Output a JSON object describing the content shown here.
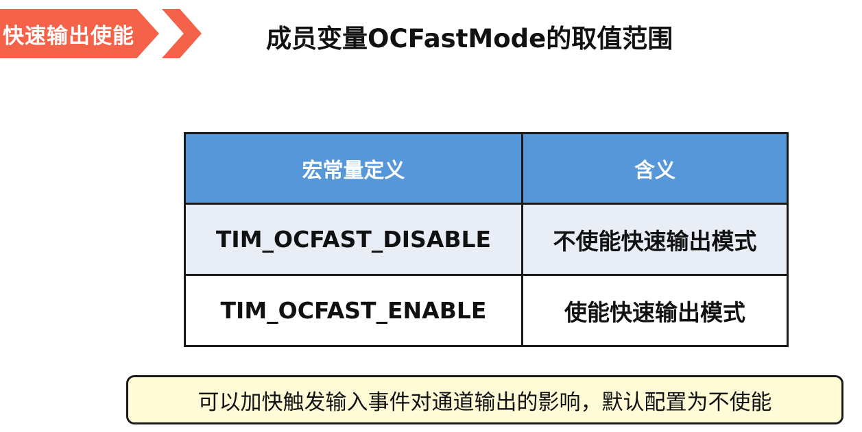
{
  "header": {
    "tag_label": "快速输出使能",
    "title": "成员变量OCFastMode的取值范围"
  },
  "table": {
    "headers": [
      "宏常量定义",
      "含义"
    ],
    "rows": [
      [
        "TIM_OCFAST_DISABLE",
        "不使能快速输出模式"
      ],
      [
        "TIM_OCFAST_ENABLE",
        "使能快速输出模式"
      ]
    ]
  },
  "note": {
    "text": "可以加快触发输入事件对通道输出的影响，默认配置为不使能"
  },
  "colors": {
    "tag": "#f4624a",
    "header_fill": "#5597d8",
    "row1_fill": "#e9edf6",
    "note_fill": "#fefbd6"
  }
}
